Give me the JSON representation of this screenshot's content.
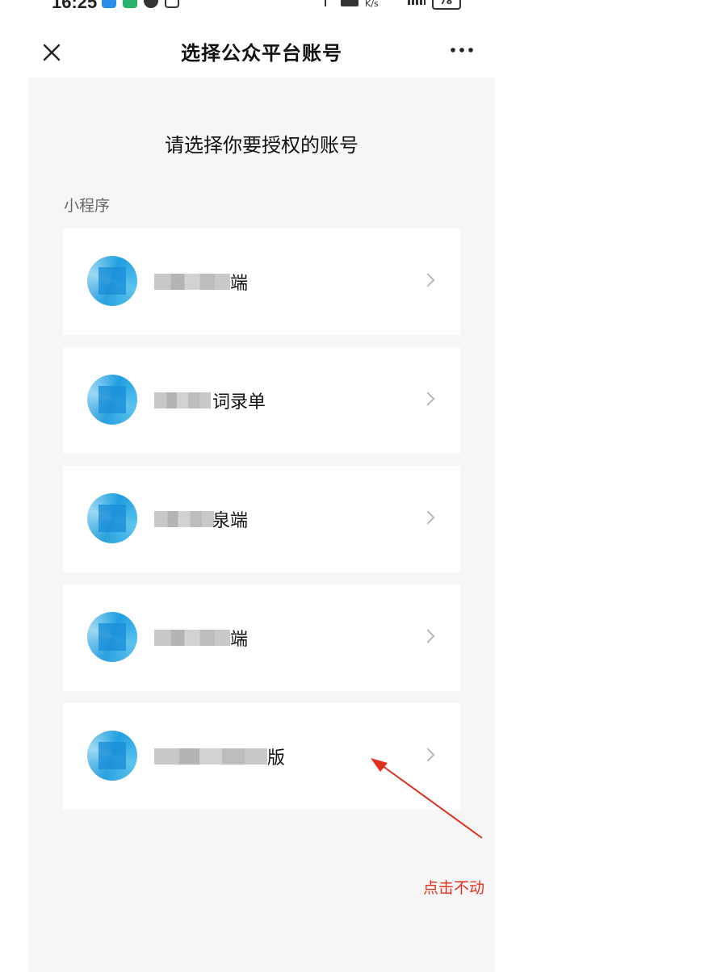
{
  "status_bar": {
    "time": "16:25",
    "network_speed": "K/s",
    "battery": "78"
  },
  "navbar": {
    "title": "选择公众平台账号",
    "close_icon": "close-icon",
    "more_icon": "more-icon"
  },
  "prompt": "请选择你要授权的账号",
  "section_label": "小程序",
  "accounts": [
    {
      "visible_suffix": "端"
    },
    {
      "visible_suffix": "词录单"
    },
    {
      "visible_suffix": "泉端"
    },
    {
      "visible_suffix": "端"
    },
    {
      "visible_suffix": "版"
    }
  ],
  "annotation": {
    "text": "点击不动",
    "color": "#e0311e"
  },
  "colors": {
    "background": "#f6f6f6",
    "card": "#ffffff",
    "accent_avatar": "#1f9ee0"
  }
}
